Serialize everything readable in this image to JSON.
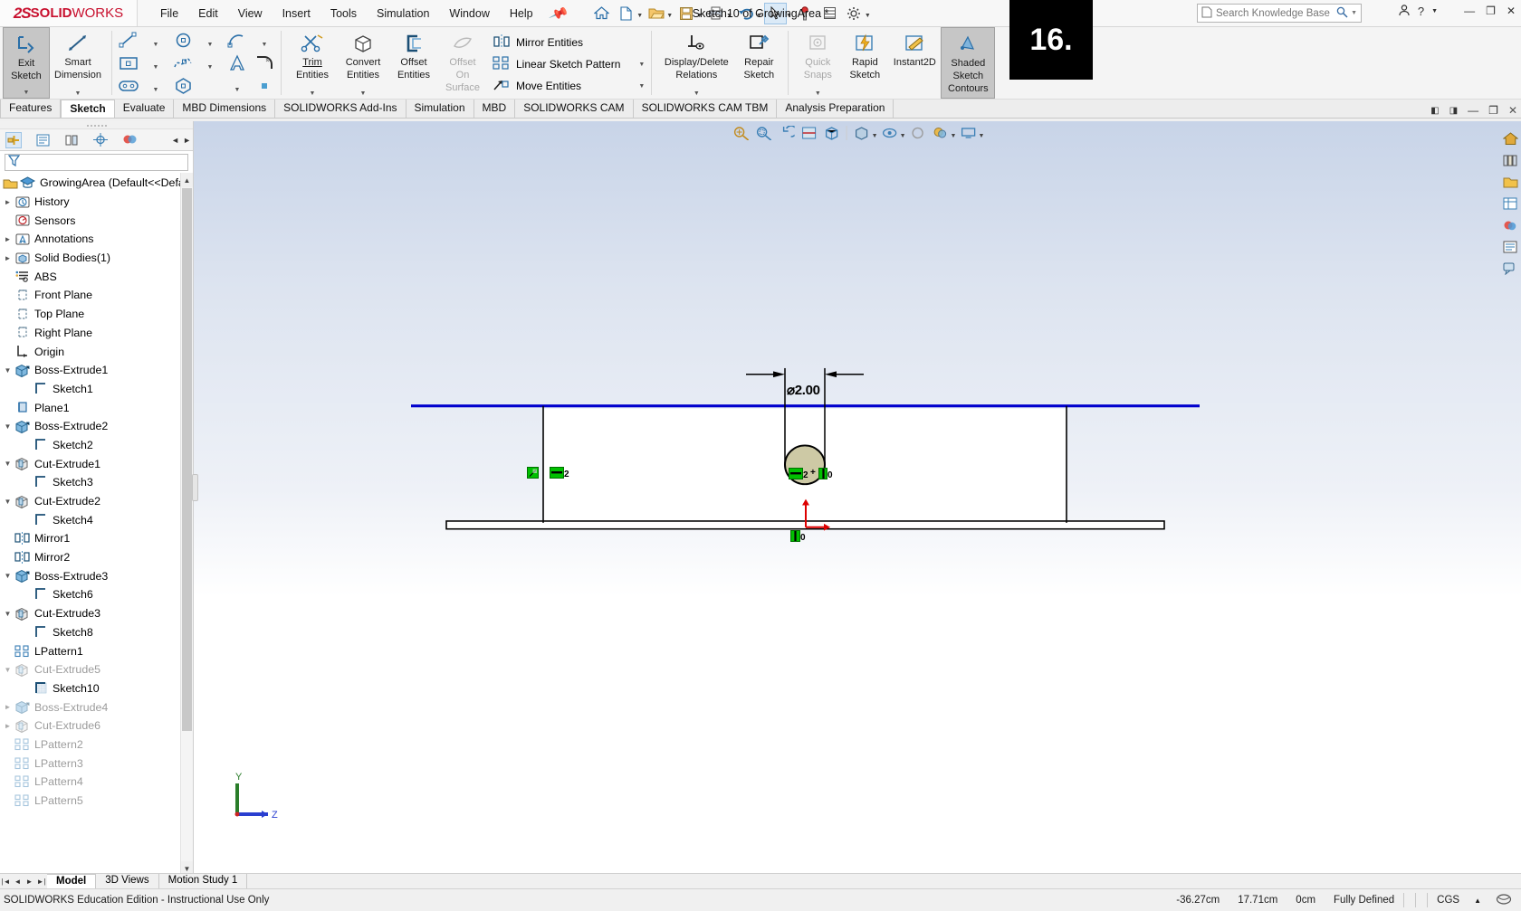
{
  "app": {
    "brand_ds": "2S",
    "brand_solid": "SOLID",
    "brand_works": "WORKS",
    "document_title": "Sketch10 of GrowingArea *"
  },
  "menubar": {
    "items": [
      "File",
      "Edit",
      "View",
      "Insert",
      "Tools",
      "Simulation",
      "Window",
      "Help"
    ],
    "pin_icon": "pushpin-icon"
  },
  "search": {
    "placeholder": "Search Knowledge Base"
  },
  "overlay_badge": {
    "text": "16."
  },
  "ribbon": {
    "exit_sketch": "Exit\nSketch",
    "exit_sketch_l1": "Exit",
    "exit_sketch_l2": "Sketch",
    "smart_dim_l1": "Smart",
    "smart_dim_l2": "Dimension",
    "trim_l1": "Trim",
    "trim_l2": "Entities",
    "convert_l1": "Convert",
    "convert_l2": "Entities",
    "offset_l1": "Offset",
    "offset_l2": "Entities",
    "offsetsurf_l1": "Offset",
    "offsetsurf_l2": "On",
    "offsetsurf_l3": "Surface",
    "mirror_entities": "Mirror Entities",
    "linear_sketch_pattern": "Linear Sketch Pattern",
    "move_entities": "Move Entities",
    "display_delete_l1": "Display/Delete",
    "display_delete_l2": "Relations",
    "repair_l1": "Repair",
    "repair_l2": "Sketch",
    "quicksnaps_l1": "Quick",
    "quicksnaps_l2": "Snaps",
    "rapid_l1": "Rapid",
    "rapid_l2": "Sketch",
    "instant2d": "Instant2D",
    "shaded_l1": "Shaded",
    "shaded_l2": "Sketch",
    "shaded_l3": "Contours"
  },
  "command_tabs": {
    "items": [
      "Features",
      "Sketch",
      "Evaluate",
      "MBD Dimensions",
      "SOLIDWORKS Add-Ins",
      "Simulation",
      "MBD",
      "SOLIDWORKS CAM",
      "SOLIDWORKS CAM TBM",
      "Analysis Preparation"
    ],
    "selected": "Sketch"
  },
  "feature_tree": {
    "root": "GrowingArea  (Default<<Defau",
    "items": [
      {
        "label": "History",
        "icon": "history-icon",
        "indent": 1,
        "arrow": "right",
        "dim": false
      },
      {
        "label": "Sensors",
        "icon": "sensors-icon",
        "indent": 1,
        "arrow": "",
        "dim": false
      },
      {
        "label": "Annotations",
        "icon": "annotations-icon",
        "indent": 1,
        "arrow": "right",
        "dim": false
      },
      {
        "label": "Solid Bodies(1)",
        "icon": "solidbodies-icon",
        "indent": 1,
        "arrow": "right",
        "dim": false
      },
      {
        "label": "ABS",
        "icon": "material-icon",
        "indent": 1,
        "arrow": "",
        "dim": false
      },
      {
        "label": "Front Plane",
        "icon": "plane-icon",
        "indent": 1,
        "arrow": "",
        "dim": false
      },
      {
        "label": "Top Plane",
        "icon": "plane-icon",
        "indent": 1,
        "arrow": "",
        "dim": false
      },
      {
        "label": "Right Plane",
        "icon": "plane-icon",
        "indent": 1,
        "arrow": "",
        "dim": false
      },
      {
        "label": "Origin",
        "icon": "origin-icon",
        "indent": 1,
        "arrow": "",
        "dim": false
      },
      {
        "label": "Boss-Extrude1",
        "icon": "boss-extrude-icon",
        "indent": 1,
        "arrow": "down",
        "dim": false
      },
      {
        "label": "Sketch1",
        "icon": "sketch-icon",
        "indent": 2,
        "arrow": "",
        "dim": false
      },
      {
        "label": "Plane1",
        "icon": "plane-blue-icon",
        "indent": 1,
        "arrow": "",
        "dim": false
      },
      {
        "label": "Boss-Extrude2",
        "icon": "boss-extrude-icon",
        "indent": 1,
        "arrow": "down",
        "dim": false
      },
      {
        "label": "Sketch2",
        "icon": "sketch-icon",
        "indent": 2,
        "arrow": "",
        "dim": false
      },
      {
        "label": "Cut-Extrude1",
        "icon": "cut-extrude-icon",
        "indent": 1,
        "arrow": "down",
        "dim": false
      },
      {
        "label": "Sketch3",
        "icon": "sketch-icon",
        "indent": 2,
        "arrow": "",
        "dim": false
      },
      {
        "label": "Cut-Extrude2",
        "icon": "cut-extrude-icon",
        "indent": 1,
        "arrow": "down",
        "dim": false
      },
      {
        "label": "Sketch4",
        "icon": "sketch-icon",
        "indent": 2,
        "arrow": "",
        "dim": false
      },
      {
        "label": "Mirror1",
        "icon": "mirror-icon",
        "indent": 1,
        "arrow": "",
        "dim": false
      },
      {
        "label": "Mirror2",
        "icon": "mirror-icon",
        "indent": 1,
        "arrow": "",
        "dim": false
      },
      {
        "label": "Boss-Extrude3",
        "icon": "boss-extrude-icon",
        "indent": 1,
        "arrow": "down",
        "dim": false
      },
      {
        "label": "Sketch6",
        "icon": "sketch-icon",
        "indent": 2,
        "arrow": "",
        "dim": false
      },
      {
        "label": "Cut-Extrude3",
        "icon": "cut-extrude-icon",
        "indent": 1,
        "arrow": "down",
        "dim": false
      },
      {
        "label": "Sketch8",
        "icon": "sketch-icon",
        "indent": 2,
        "arrow": "",
        "dim": false
      },
      {
        "label": "LPattern1",
        "icon": "lpattern-icon",
        "indent": 1,
        "arrow": "",
        "dim": false
      },
      {
        "label": "Cut-Extrude5",
        "icon": "cut-extrude-icon",
        "indent": 1,
        "arrow": "down",
        "dim": true
      },
      {
        "label": "Sketch10",
        "icon": "sketch-active-icon",
        "indent": 2,
        "arrow": "",
        "dim": false
      },
      {
        "label": "Boss-Extrude4",
        "icon": "boss-extrude-icon",
        "indent": 1,
        "arrow": "right",
        "dim": true
      },
      {
        "label": "Cut-Extrude6",
        "icon": "cut-extrude-icon",
        "indent": 1,
        "arrow": "right",
        "dim": true
      },
      {
        "label": "LPattern2",
        "icon": "lpattern-icon",
        "indent": 1,
        "arrow": "",
        "dim": true
      },
      {
        "label": "LPattern3",
        "icon": "lpattern-icon",
        "indent": 1,
        "arrow": "",
        "dim": true
      },
      {
        "label": "LPattern4",
        "icon": "lpattern-icon",
        "indent": 1,
        "arrow": "",
        "dim": true
      },
      {
        "label": "LPattern5",
        "icon": "lpattern-icon",
        "indent": 1,
        "arrow": "",
        "dim": true
      }
    ]
  },
  "sketch": {
    "dimension_label": "⌀2.00",
    "relation_left_count": "2",
    "relation_circle_count": "2",
    "relation_circle_plus": "+",
    "relation_circle_zero": "0",
    "relation_origin_zero": "0",
    "circle_fill_color": "#cdc9a5",
    "top_edge_color": "#0000cd",
    "triad_x_label": "Z",
    "triad_y_label": "Y"
  },
  "bottom_tabs": {
    "items": [
      "Model",
      "3D Views",
      "Motion Study 1"
    ],
    "selected": "Model"
  },
  "status_bar": {
    "license": "SOLIDWORKS Education Edition - Instructional Use Only",
    "coord_x": "-36.27cm",
    "coord_y": "17.71cm",
    "coord_z": "0cm",
    "state": "Fully Defined",
    "units": "CGS",
    "units_caret": "▲"
  }
}
